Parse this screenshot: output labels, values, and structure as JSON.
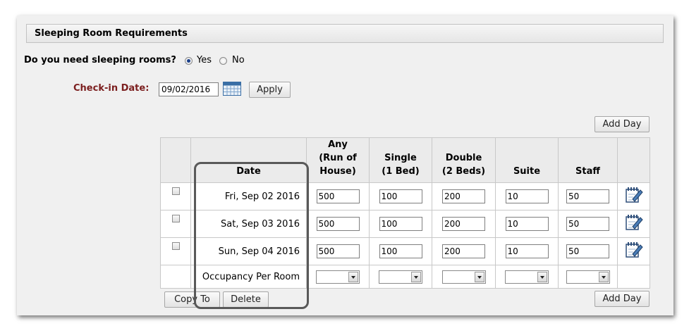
{
  "section": {
    "title": "Sleeping Room Requirements"
  },
  "question": {
    "text": "Do you need sleeping rooms?",
    "options": [
      {
        "label": "Yes",
        "selected": true
      },
      {
        "label": "No",
        "selected": false
      }
    ]
  },
  "checkin": {
    "label": "Check-in Date:",
    "value": "09/02/2016",
    "apply_label": "Apply"
  },
  "add_day_label": "Add Day",
  "table": {
    "columns": [
      {
        "l1": "",
        "l2": "",
        "l3": ""
      },
      {
        "l1": "",
        "l2": "",
        "l3": "Date"
      },
      {
        "l1": "Any",
        "l2": "(Run of",
        "l3": "House)"
      },
      {
        "l1": "",
        "l2": "Single",
        "l3": "(1 Bed)"
      },
      {
        "l1": "",
        "l2": "Double",
        "l3": "(2 Beds)"
      },
      {
        "l1": "",
        "l2": "",
        "l3": "Suite"
      },
      {
        "l1": "",
        "l2": "",
        "l3": "Staff"
      },
      {
        "l1": "",
        "l2": "",
        "l3": ""
      }
    ],
    "rows": [
      {
        "date": "Fri, Sep 02 2016",
        "any": "500",
        "single": "100",
        "double": "200",
        "suite": "10",
        "staff": "50"
      },
      {
        "date": "Sat, Sep 03 2016",
        "any": "500",
        "single": "100",
        "double": "200",
        "suite": "10",
        "staff": "50"
      },
      {
        "date": "Sun, Sep 04 2016",
        "any": "500",
        "single": "100",
        "double": "200",
        "suite": "10",
        "staff": "50"
      }
    ],
    "occupancy_label": "Occupancy Per Room"
  },
  "footer": {
    "copy_label": "Copy To",
    "delete_label": "Delete"
  },
  "colors": {
    "checkin_label": "#7b1e1e",
    "highlight_border": "#595959",
    "radio_dot": "#1b3f8a"
  },
  "icons": {
    "calendar": "calendar-icon",
    "edit": "edit-notepad-icon"
  }
}
